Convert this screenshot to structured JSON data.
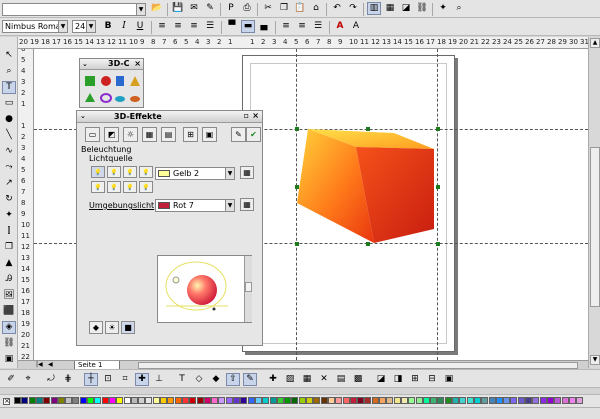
{
  "toolbar1": {
    "apply_style_value": "",
    "buttons": [
      "open-icon",
      "save-icon",
      "mail-icon",
      "edit-icon",
      "pdf-icon",
      "print-icon",
      "cut-icon",
      "copy-icon",
      "paste-icon",
      "clone-format-icon",
      "undo-icon",
      "redo-icon",
      "chart-icon",
      "table-icon",
      "insert-object-icon",
      "hyperlink-icon",
      "navigator-icon",
      "zoom-icon"
    ]
  },
  "toolbar2": {
    "font_name": "Nimbus Roman",
    "font_size": "24",
    "bold": "B",
    "italic": "I",
    "underline": "U",
    "strike": "A"
  },
  "ruler": {
    "h_numbers": [
      "21",
      "20",
      "19",
      "18",
      "17",
      "16",
      "15",
      "14",
      "13",
      "12",
      "11",
      "10",
      "9",
      "8",
      "7",
      "6",
      "5",
      "4",
      "3",
      "2",
      "1",
      "",
      "1",
      "2",
      "3",
      "4",
      "5",
      "6",
      "7",
      "8",
      "9",
      "10",
      "11",
      "12",
      "13",
      "14",
      "15",
      "16",
      "17",
      "18",
      "19",
      "20",
      "21",
      "22",
      "23",
      "24",
      "25",
      "26",
      "27",
      "28",
      "29",
      "30",
      "31"
    ],
    "v_numbers": [
      "6",
      "5",
      "4",
      "3",
      "2",
      "1",
      "",
      "1",
      "2",
      "3",
      "4",
      "5",
      "6",
      "7",
      "8",
      "9",
      "10",
      "11",
      "12",
      "13",
      "14",
      "15",
      "16",
      "17",
      "18",
      "19",
      "20",
      "21",
      "22",
      "23"
    ]
  },
  "small_panel": {
    "title": "3D-C"
  },
  "effects_panel": {
    "title": "3D-Effekte",
    "section": "Beleuchtung",
    "light_source_label": "Lichtquelle",
    "light_color": "Gelb 2",
    "light_color_hex": "#ffff99",
    "ambient_label": "Umgebungslicht",
    "ambient_color": "Rot 7",
    "ambient_color_hex": "#c21f3a"
  },
  "status": {
    "page_tab": "Seite 1"
  },
  "palette": [
    "#000000",
    "#000080",
    "#008000",
    "#008080",
    "#800000",
    "#800080",
    "#808000",
    "#c0c0c0",
    "#808080",
    "#0000ff",
    "#00ff00",
    "#00ffff",
    "#ff0000",
    "#ff00ff",
    "#ffff00",
    "#ffffff",
    "#b8b8b8",
    "#cfcfcf",
    "#e6e6e6",
    "#ffff99",
    "#ffcc00",
    "#ff9900",
    "#ff6600",
    "#ff3333",
    "#cc0000",
    "#990000",
    "#cc0066",
    "#ff66cc",
    "#cc99ff",
    "#9966ff",
    "#6633cc",
    "#330099",
    "#3366ff",
    "#66ccff",
    "#00cccc",
    "#009999",
    "#33cc33",
    "#009900",
    "#006600",
    "#99cc00",
    "#cccc00",
    "#996600",
    "#663300",
    "#ffcc99",
    "#ff9999",
    "#ff6666",
    "#c21f3a",
    "#800020",
    "#a52a2a",
    "#d2691e",
    "#f4a460",
    "#deb887",
    "#f0e68c",
    "#eee8aa",
    "#98fb98",
    "#90ee90",
    "#00fa9a",
    "#3cb371",
    "#2e8b57",
    "#228b22",
    "#20b2aa",
    "#48d1cc",
    "#40e0d0",
    "#00ced1",
    "#5f9ea0",
    "#4682b4",
    "#1e90ff",
    "#6495ed",
    "#7b68ee",
    "#6a5acd",
    "#483d8b",
    "#9370db",
    "#8a2be2",
    "#9400d3",
    "#ba55d3",
    "#da70d6",
    "#ee82ee",
    "#dda0dd"
  ]
}
